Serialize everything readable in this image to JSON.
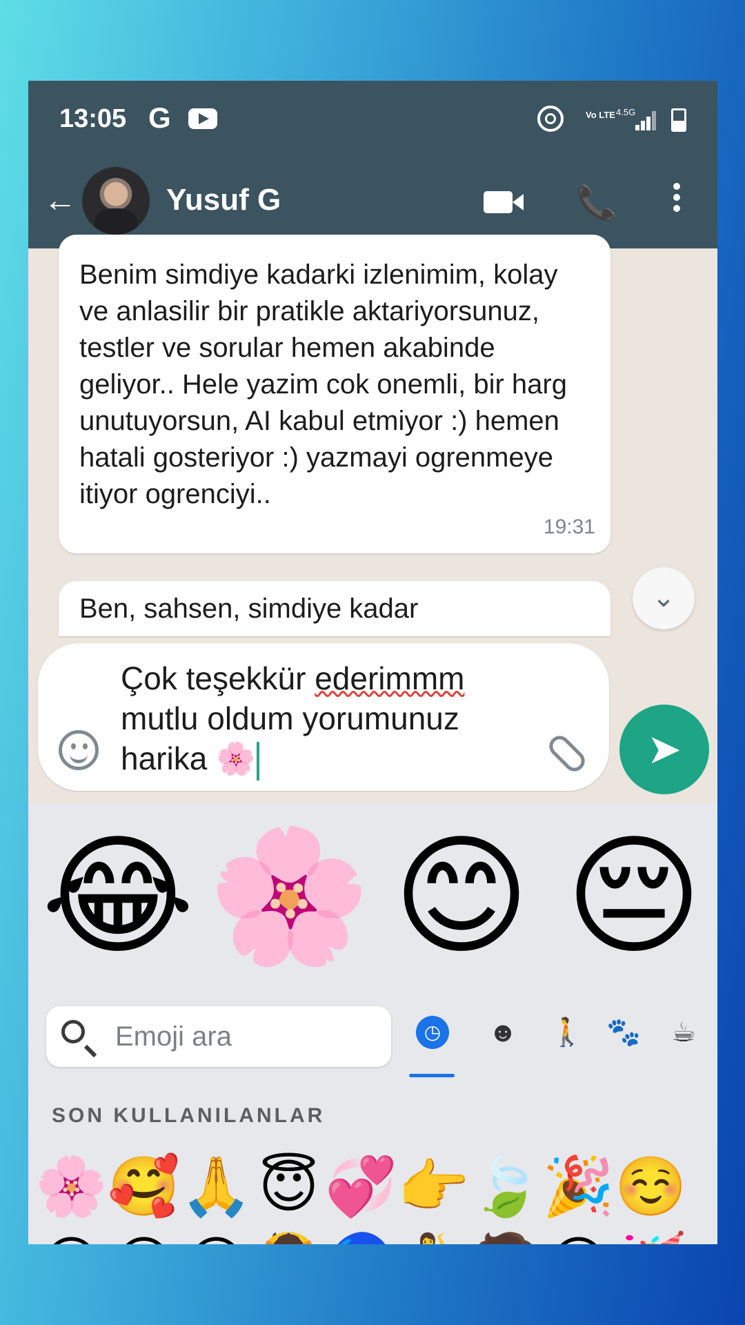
{
  "status_bar": {
    "time": "13:05",
    "g_label": "G",
    "volte_label": "Vo LTE",
    "network_label": "4.5G"
  },
  "header": {
    "contact_name": "Yusuf G"
  },
  "messages": [
    {
      "text": "Benim simdiye kadarki izlenimim, kolay ve anlasilir bir pratikle aktariyorsunuz, testler ve sorular hemen akabinde geliyor.. Hele yazim cok onemli, bir harg unutuyorsun, AI kabul etmiyor :) hemen hatali gosteriyor :) yazmayi ogrenmeye itiyor ogrenciyi..",
      "time": "19:31"
    },
    {
      "text": "Ben, sahsen, simdiye kadar"
    }
  ],
  "composer": {
    "line1_prefix": "Çok teşekkür ",
    "line1_misspelled": "ederimmm",
    "line2": "mutlu oldum yorumunuz",
    "line3": "harika 🌸"
  },
  "emoji_suggestions": [
    "😂",
    "🌸",
    "😊",
    "😔"
  ],
  "emoji_keyboard": {
    "search_placeholder": "Emoji ara",
    "categories": [
      "recent-icon",
      "smiley-icon",
      "people-icon",
      "animals-icon",
      "food-icon"
    ],
    "section_label": "SON KULLANILANLAR",
    "recent_emojis": [
      "🌸",
      "🥰",
      "🙏",
      "😇",
      "💞",
      "👉",
      "🍃",
      "🎉",
      "☺️"
    ],
    "row2_emojis": [
      "😂",
      "😅",
      "😊",
      "🙆",
      "🧿",
      "💃",
      "🧑",
      "😄",
      "🥳"
    ]
  },
  "colors": {
    "header": "#3c5360",
    "send_button": "#1da586",
    "accent": "#1a73e8"
  }
}
